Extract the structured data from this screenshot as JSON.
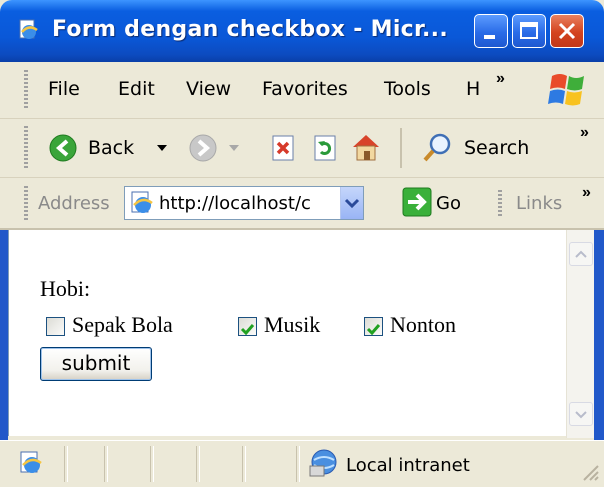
{
  "window": {
    "title": "Form dengan checkbox - Micr..."
  },
  "menubar": {
    "items": [
      "File",
      "Edit",
      "View",
      "Favorites",
      "Tools",
      "H"
    ],
    "overflow": "»"
  },
  "toolbar": {
    "back_label": "Back",
    "search_label": "Search",
    "overflow": "»"
  },
  "addressbar": {
    "label": "Address",
    "url": "http://localhost/c",
    "go_label": "Go",
    "links_label": "Links",
    "overflow": "»"
  },
  "page": {
    "hobi_label": "Hobi:",
    "checkboxes": [
      {
        "label": "Sepak Bola",
        "checked": false
      },
      {
        "label": "Musik",
        "checked": true
      },
      {
        "label": "Nonton",
        "checked": true
      }
    ],
    "submit_label": "submit"
  },
  "statusbar": {
    "zone_label": "Local intranet"
  },
  "colors": {
    "titlebar": "#0a5ee0",
    "close_button": "#d4431e",
    "chrome": "#ece9d8",
    "checkmark": "#21a121",
    "go_arrow": "#3ab03a"
  }
}
